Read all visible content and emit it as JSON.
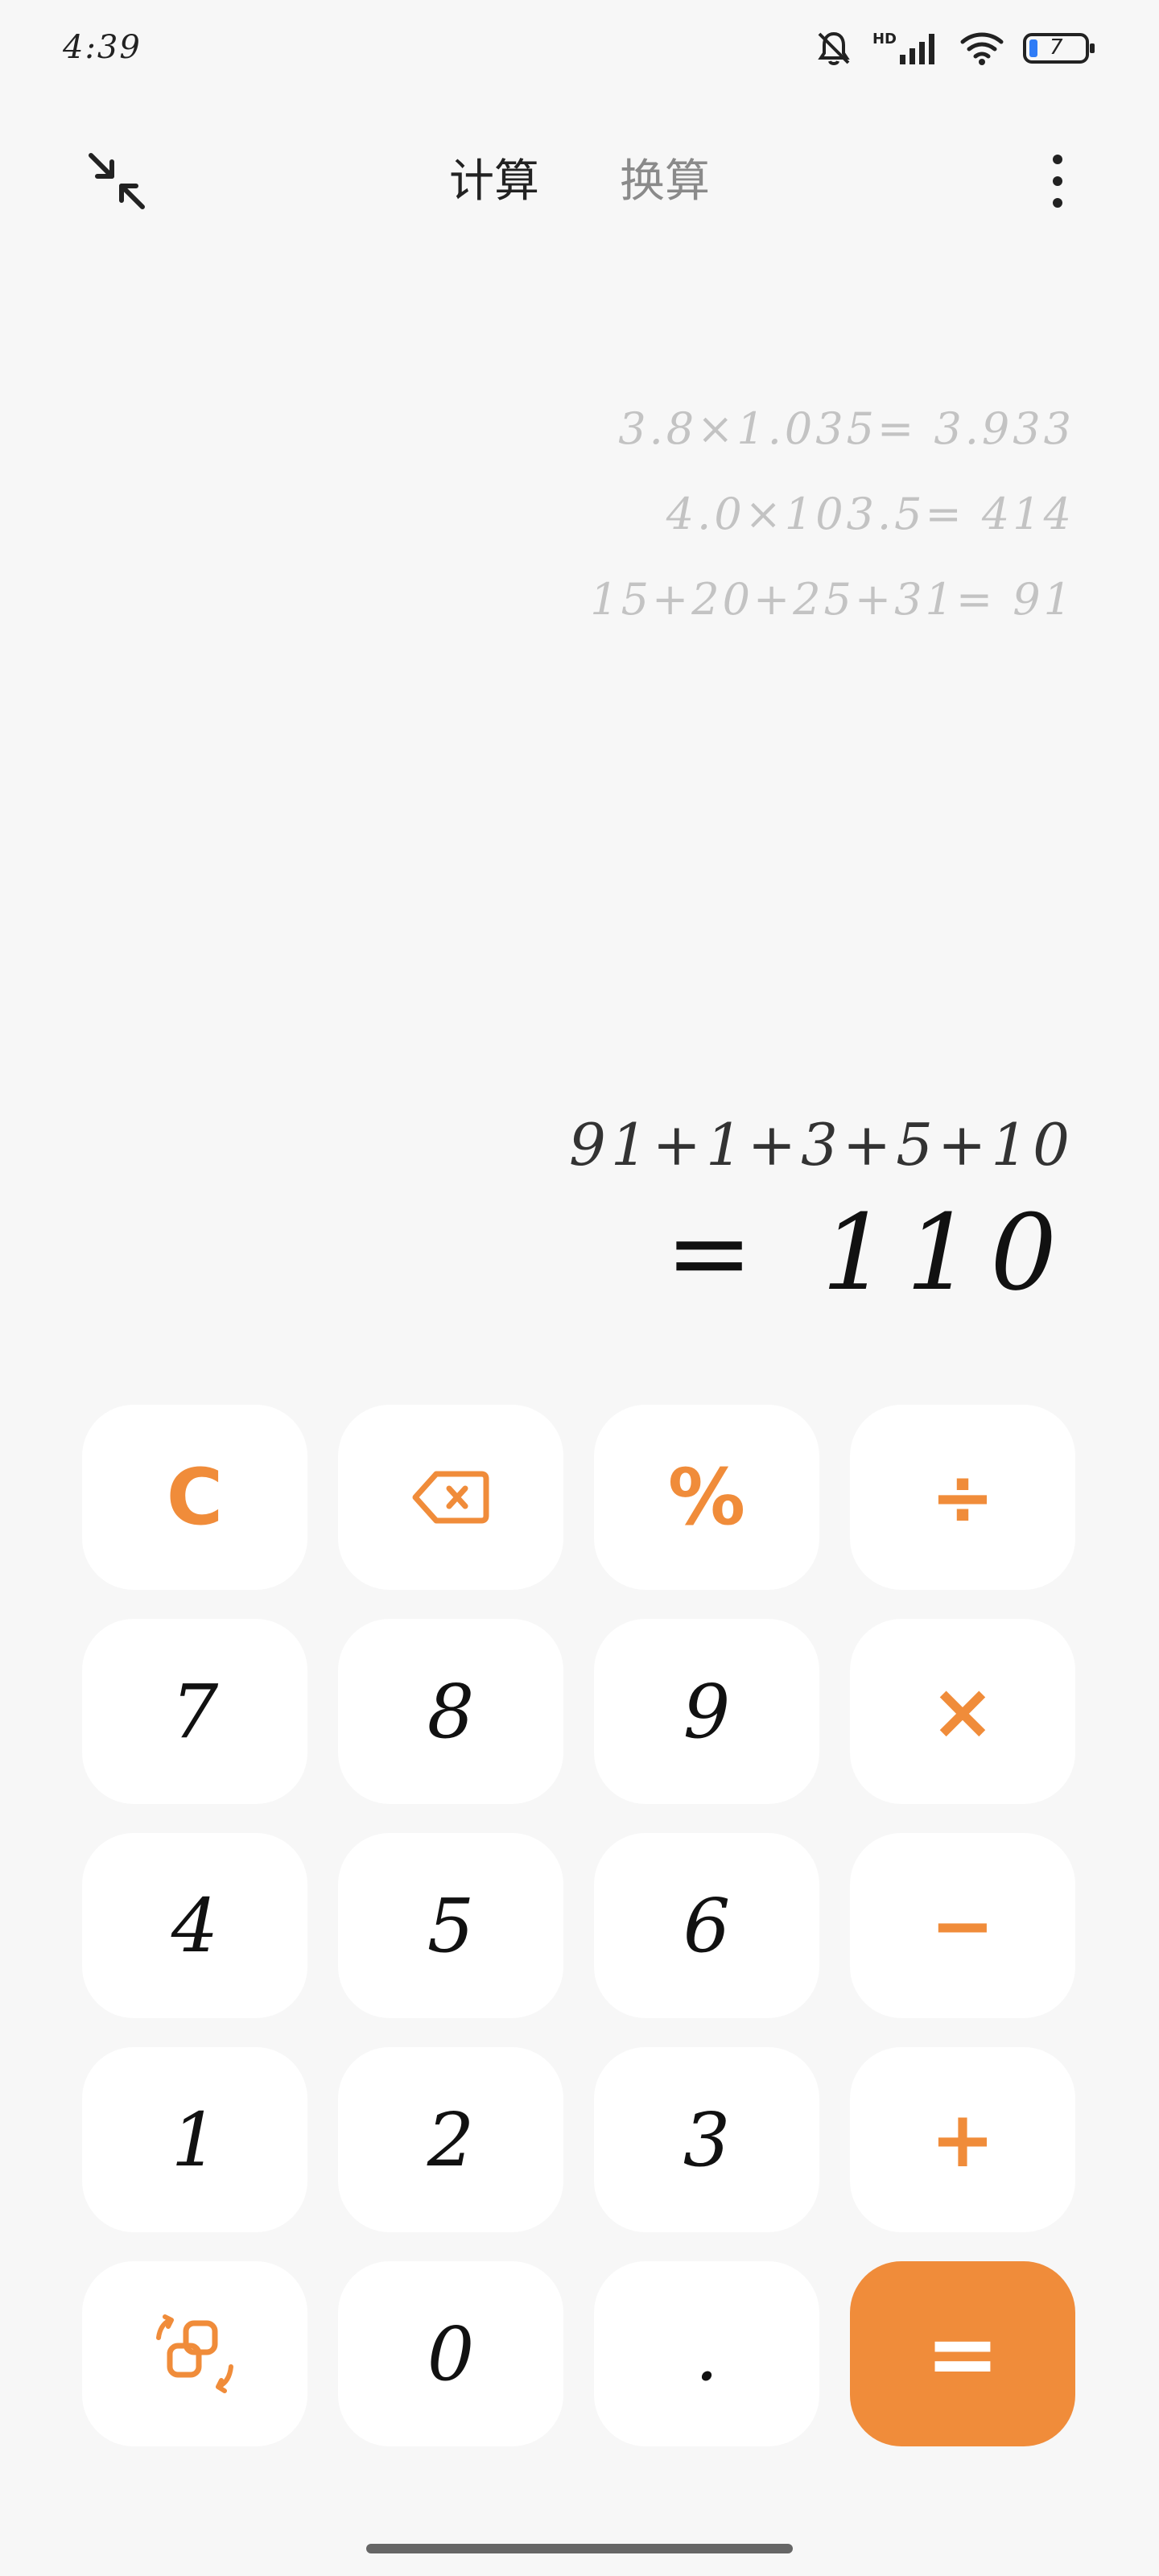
{
  "status": {
    "time": "4:39",
    "signal_label": "HD",
    "battery": "7",
    "icons": [
      "bell-muted-icon",
      "signal-icon",
      "wifi-icon",
      "battery-icon"
    ]
  },
  "header": {
    "tabs": [
      {
        "label": "计算",
        "active": true
      },
      {
        "label": "换算",
        "active": false
      }
    ],
    "icons": [
      "collapse-icon",
      "more-vertical-icon"
    ]
  },
  "history": [
    "3.8×1.035= 3.933",
    "4.0×103.5= 414",
    "15+20+25+31= 91"
  ],
  "display": {
    "expression": "91+1+3+5+10",
    "result": "= 110"
  },
  "keypad": {
    "row1": [
      "C",
      "backspace-icon",
      "%",
      "÷"
    ],
    "row2": [
      "7",
      "8",
      "9",
      "×"
    ],
    "row3": [
      "4",
      "5",
      "6",
      "−"
    ],
    "row4": [
      "1",
      "2",
      "3",
      "+"
    ],
    "row5": [
      "swap-icon",
      "0",
      ".",
      "="
    ],
    "accent_color": "#F08C3A"
  }
}
